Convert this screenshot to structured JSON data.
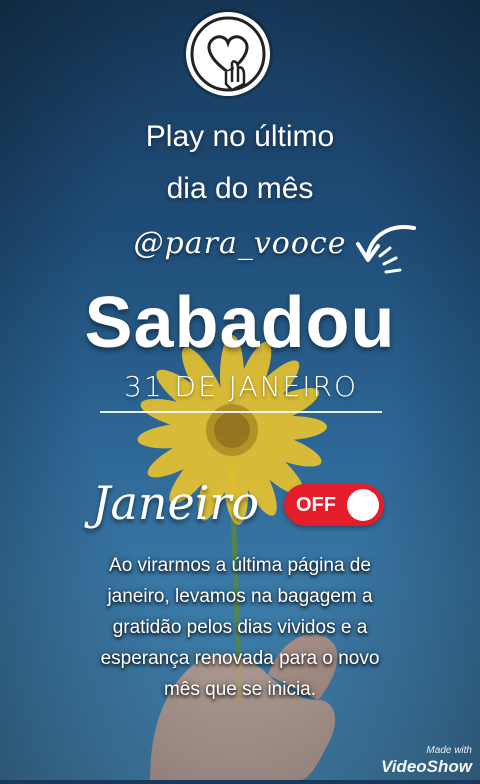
{
  "header": {
    "icon": "heart-touch-icon",
    "line1": "Play no último",
    "line2": "dia do mês"
  },
  "handle": "@para_vooce",
  "main": {
    "day": "Sabadou",
    "date": "31 DE JANEIRO",
    "month": "Janeiro",
    "toggle_label": "OFF"
  },
  "message": {
    "lines": [
      "Ao virarmos a última página de",
      "janeiro, levamos na bagagem a",
      "gratidão pelos dias vividos e a",
      "esperança renovada para o novo",
      "mês que se inicia."
    ]
  },
  "watermark": {
    "small": "Made with",
    "big": "VideoShow"
  },
  "colors": {
    "toggle": "#e51d2a",
    "sky": "#2c6594",
    "petal": "#f5c928"
  }
}
